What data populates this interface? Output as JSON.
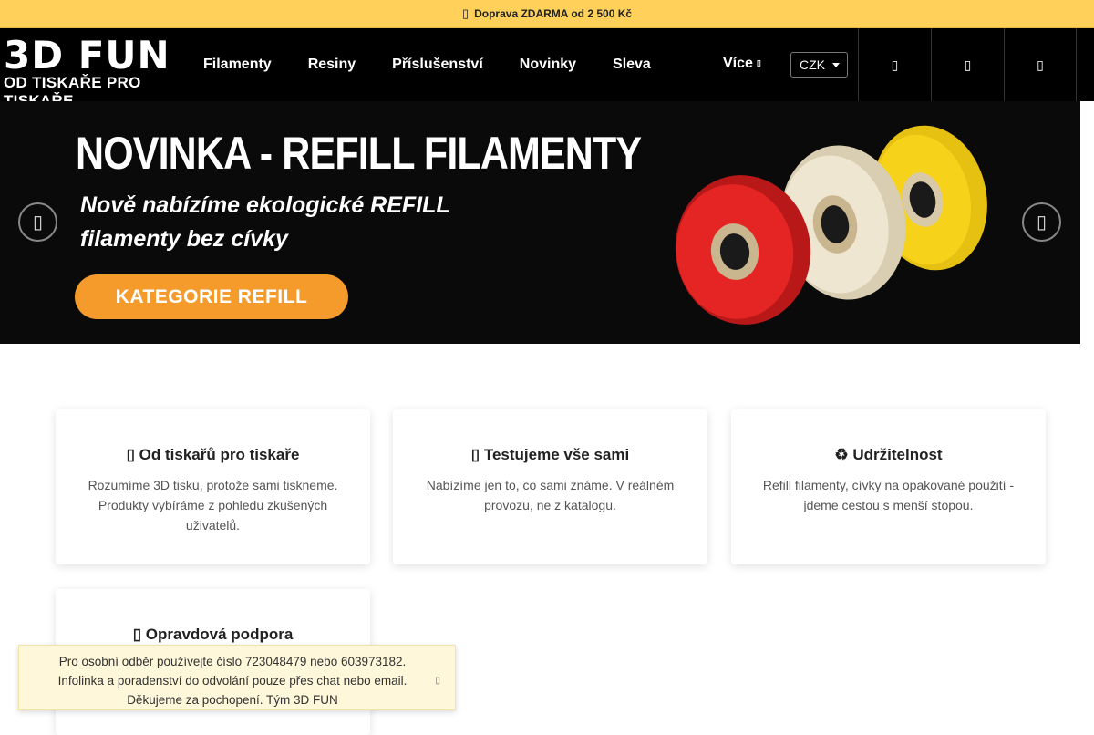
{
  "topbar": {
    "icon": "truck-icon",
    "text": "Doprava ZDARMA od 2 500 Kč"
  },
  "header": {
    "logo_main": "3D FUN",
    "logo_sub": "OD TISKAŘE PRO TISKAŘE",
    "nav": [
      "Filamenty",
      "Resiny",
      "Příslušenství",
      "Novinky",
      "Sleva"
    ],
    "more_label": "Více",
    "currency": "CZK",
    "icons": [
      "search-icon",
      "user-icon",
      "cart-icon"
    ]
  },
  "banner": {
    "title": "NOVINKA - REFILL FILAMENTY",
    "subtitle": "Nově nabízíme ekologické REFILL filamenty bez cívky",
    "cta": "KATEGORIE REFILL",
    "colors": {
      "cta": "#f59b2c",
      "spool_red": "#e52424",
      "spool_cream": "#efe6d2",
      "spool_yellow": "#f6d21b"
    }
  },
  "features": [
    {
      "icon": "printer-icon",
      "title": "Od tiskařů pro tiskaře",
      "text": "Rozumíme 3D tisku, protože sami tiskneme. Produkty vybíráme z pohledu zkušených uživatelů."
    },
    {
      "icon": "flask-icon",
      "title": "Testujeme vše sami",
      "text": "Nabízíme jen to, co sami známe. V reálném provozu, ne z katalogu."
    },
    {
      "icon": "recycle-icon",
      "title": "♻ Udržitelnost",
      "text": "Refill filamenty, cívky na opakované použití - jdeme cestou s menší stopou."
    },
    {
      "icon": "wrench-icon",
      "title": "Opravdová podpora",
      "text": ""
    }
  ],
  "notice": {
    "line1": "Pro osobní odběr používejte číslo 723048479 nebo 603973182.",
    "line2": "Infolinka a poradenství do odvolání pouze přes chat nebo email.",
    "line3": "Děkujeme za pochopení. Tým 3D FUN"
  }
}
